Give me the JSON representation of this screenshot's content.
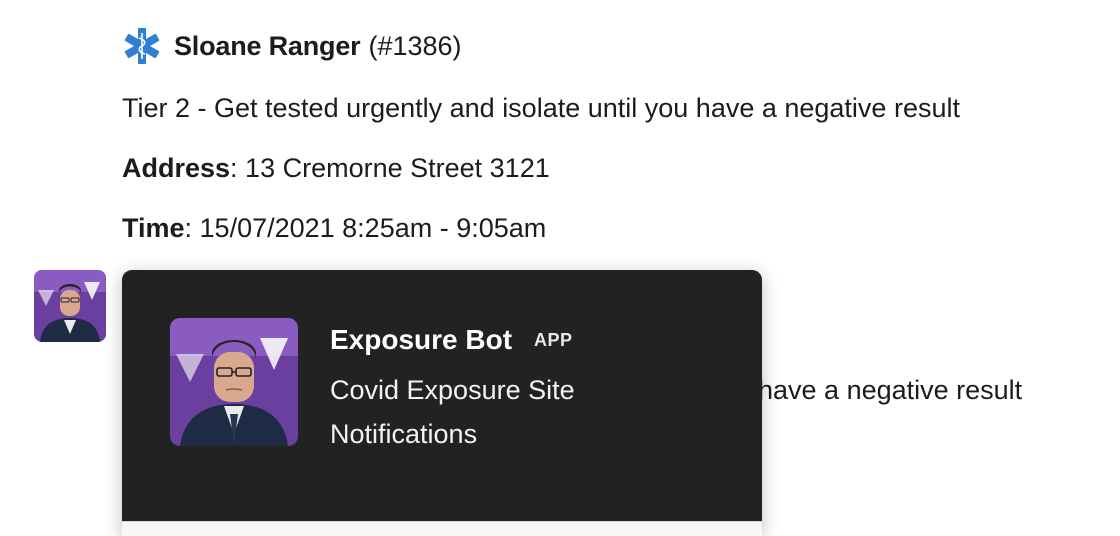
{
  "message1": {
    "icon": "medical-star-icon",
    "sender_name": "Sloane Ranger",
    "sender_id": "(#1386)",
    "tier_line": "Tier 2 - Get tested urgently and isolate until you have a negative result",
    "address_label": "Address",
    "address_value": ": 13 Cremorne Street 3121",
    "time_label": "Time",
    "time_value": ": 15/07/2021 8:25am - 9:05am"
  },
  "message2": {
    "visible_text": "have a negative result"
  },
  "hover_card": {
    "name": "Exposure Bot",
    "badge": "APP",
    "description": "Covid Exposure Site Notifications"
  },
  "colors": {
    "popover_bg": "#222222",
    "avatar_bg": "#6b3fa0",
    "medical_star": "#2f7fd6"
  }
}
